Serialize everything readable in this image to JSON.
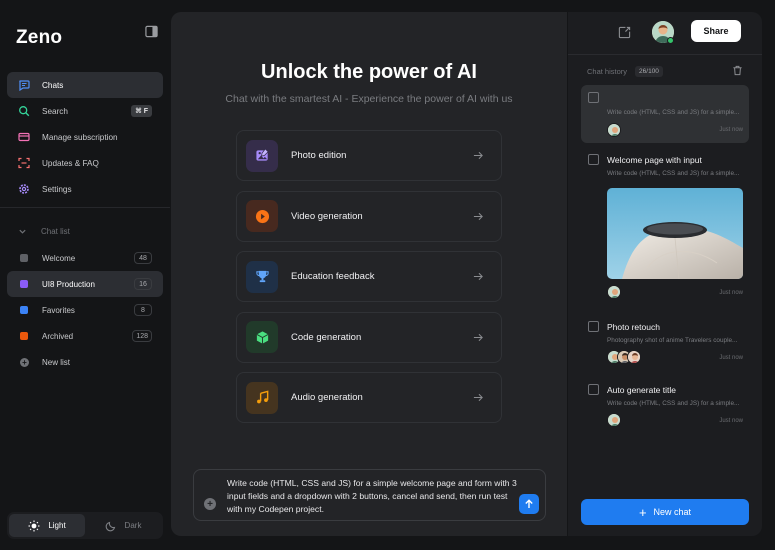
{
  "app": {
    "name": "Zeno"
  },
  "sidebar": {
    "nav": [
      {
        "label": "Chats",
        "icon": "chat-icon"
      },
      {
        "label": "Search",
        "icon": "search-icon",
        "shortcut": "⌘ F"
      },
      {
        "label": "Manage subscription",
        "icon": "card-icon"
      },
      {
        "label": "Updates & FAQ",
        "icon": "scan-icon"
      },
      {
        "label": "Settings",
        "icon": "gear-icon"
      }
    ],
    "chat_list_title": "Chat list",
    "lists": [
      {
        "label": "Welcome",
        "count": "48",
        "color": "#5f6166"
      },
      {
        "label": "UI8 Production",
        "count": "16",
        "color": "#8b5cf6"
      },
      {
        "label": "Favorites",
        "count": "8",
        "color": "#3b82f6"
      },
      {
        "label": "Archived",
        "count": "128",
        "color": "#ea580c"
      }
    ],
    "new_list": "New list",
    "theme": {
      "light": "Light",
      "dark": "Dark"
    }
  },
  "main": {
    "title": "Unlock the power of AI",
    "subtitle": "Chat with the smartest AI - Experience the power of AI with us",
    "features": [
      {
        "label": "Photo edition",
        "icon": "image-edit-icon",
        "bg": "#352d4a",
        "color": "#a78bfa"
      },
      {
        "label": "Video generation",
        "icon": "play-icon",
        "bg": "#47291f",
        "color": "#f97316"
      },
      {
        "label": "Education feedback",
        "icon": "trophy-icon",
        "bg": "#1f3047",
        "color": "#60a5fa"
      },
      {
        "label": "Code generation",
        "icon": "cube-icon",
        "bg": "#213a2a",
        "color": "#4ade80"
      },
      {
        "label": "Audio generation",
        "icon": "music-icon",
        "bg": "#45341f",
        "color": "#f59e0b"
      }
    ],
    "composer_text": "Write code (HTML, CSS and JS) for a simple welcome page and form with 3 input fields and a dropdown with 2 buttons, cancel and send, then run test with my Codepen project."
  },
  "right": {
    "share_label": "Share",
    "history_label": "Chat history",
    "history_count": "26/100",
    "chats": [
      {
        "title": "",
        "preview": "Write code (HTML, CSS and JS) for a simple...",
        "time": "Just now"
      },
      {
        "title": "Welcome page with input",
        "preview": "Write code (HTML, CSS and JS) for a simple...",
        "time": "Just now"
      },
      {
        "title": "Photo retouch",
        "preview": "Photography shot of anime Travelers couple...",
        "time": "Just now"
      },
      {
        "title": "Auto generate title",
        "preview": "Write code (HTML, CSS and JS) for a simple...",
        "time": "Just now"
      }
    ],
    "new_chat_label": "New chat"
  },
  "colors": {
    "accent": "#1f7cf0",
    "online": "#35c46b"
  }
}
